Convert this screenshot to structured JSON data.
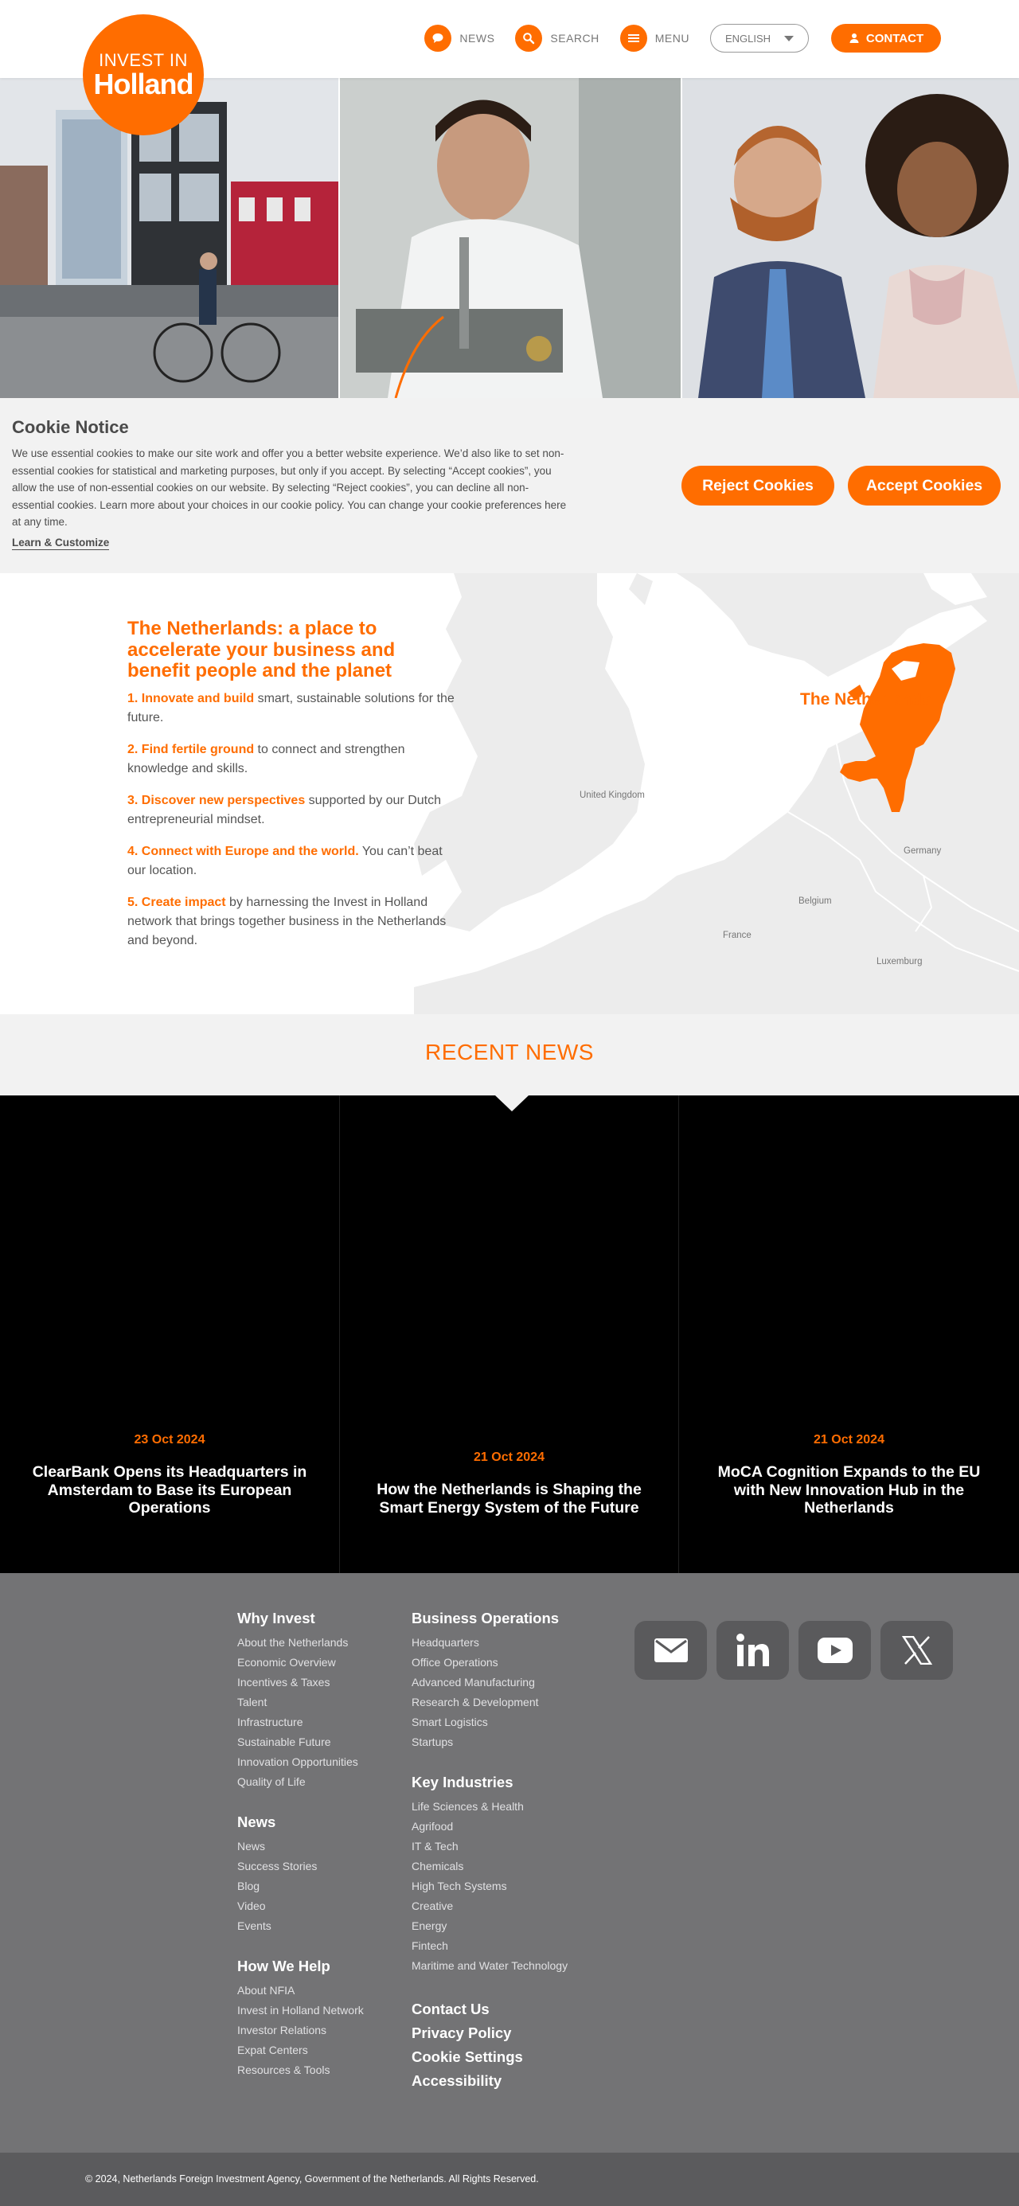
{
  "header": {
    "logo_line1": "INVEST IN",
    "logo_line2": "Holland",
    "nav": [
      {
        "label": "NEWS",
        "icon": "speech-bubble-icon"
      },
      {
        "label": "SEARCH",
        "icon": "search-icon"
      },
      {
        "label": "MENU",
        "icon": "menu-icon"
      }
    ],
    "language": "ENGLISH",
    "contact_label": "CONTACT"
  },
  "cookie": {
    "title": "Cookie Notice",
    "body": "We use essential cookies to make our site work and offer you a better website experience. We’d also like to set non-essential cookies for statistical and marketing purposes, but only if you accept. By selecting “Accept cookies”, you allow the use of non-essential cookies on our website. By selecting “Reject cookies”, you can decline all non-essential cookies. Learn more about your choices in our cookie policy. You can change your cookie preferences here at any time.",
    "learn": "Learn & Customize",
    "reject": "Reject Cookies",
    "accept": "Accept Cookies"
  },
  "netherlands": {
    "heading": "The Netherlands: a place to accelerate your business and benefit people and the planet",
    "points": [
      {
        "lead": "1. Innovate and build",
        "rest": " smart, sustainable solutions for the future."
      },
      {
        "lead": "2. Find fertile ground",
        "rest": " to connect and strengthen knowledge and skills."
      },
      {
        "lead": "3. Discover new perspectives",
        "rest": " supported by our Dutch entrepreneurial mindset."
      },
      {
        "lead": "4. Connect with Europe and the world.",
        "rest": " You can’t beat our location."
      },
      {
        "lead": "5. Create impact",
        "rest": " by harnessing the Invest in Holland network that brings together business in the Netherlands and beyond."
      }
    ],
    "map_label": "The Netherlands",
    "countries": {
      "uk": "United Kingdom",
      "germany": "Germany",
      "belgium": "Belgium",
      "france": "France",
      "luxemburg": "Luxemburg"
    }
  },
  "news": {
    "heading": "RECENT NEWS",
    "items": [
      {
        "date": "23 Oct 2024",
        "title": "ClearBank Opens its Headquarters in Amsterdam to Base its European Operations"
      },
      {
        "date": "21 Oct 2024",
        "title": "How the Netherlands is Shaping the Smart Energy System of the Future"
      },
      {
        "date": "21 Oct 2024",
        "title": "MoCA Cognition Expands to the EU with New Innovation Hub in the Netherlands"
      }
    ]
  },
  "footer": {
    "why_invest": {
      "title": "Why Invest",
      "links": [
        "About the Netherlands",
        "Economic Overview",
        "Incentives & Taxes",
        "Talent",
        "Infrastructure",
        "Sustainable Future",
        "Innovation Opportunities",
        "Quality of Life"
      ]
    },
    "news": {
      "title": "News",
      "links": [
        "News",
        "Success Stories",
        "Blog",
        "Video",
        "Events"
      ]
    },
    "how_we_help": {
      "title": "How We Help",
      "links": [
        "About NFIA",
        "Invest in Holland Network",
        "Investor Relations",
        "Expat Centers",
        "Resources & Tools"
      ]
    },
    "business_operations": {
      "title": "Business Operations",
      "links": [
        "Headquarters",
        "Office Operations",
        "Advanced Manufacturing",
        "Research & Development",
        "Smart Logistics",
        "Startups"
      ]
    },
    "key_industries": {
      "title": "Key Industries",
      "links": [
        "Life Sciences & Health",
        "Agrifood",
        "IT & Tech",
        "Chemicals",
        "High Tech Systems",
        "Creative",
        "Energy",
        "Fintech",
        "Maritime and Water Technology"
      ]
    },
    "bold_links": [
      "Contact Us",
      "Privacy Policy",
      "Cookie Settings",
      "Accessibility"
    ],
    "socials": [
      "email-icon",
      "linkedin-icon",
      "youtube-icon",
      "x-icon"
    ],
    "copyright": "© 2024, Netherlands Foreign Investment Agency, Government of the Netherlands. All Rights Reserved."
  },
  "colors": {
    "brand_orange": "#ff6d00",
    "footer_grey": "#737375",
    "bottom_bar": "#5b5b5d"
  }
}
